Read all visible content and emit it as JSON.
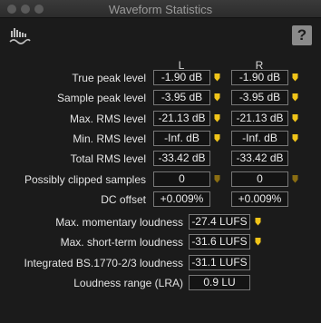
{
  "window": {
    "title": "Waveform Statistics"
  },
  "header": {
    "help_label": "?"
  },
  "columns": {
    "left": "L",
    "right": "R"
  },
  "rows": [
    {
      "label": "True peak level",
      "left": "-1.90 dB",
      "right": "-1.90 dB",
      "left_marker": "bright",
      "right_marker": "bright"
    },
    {
      "label": "Sample peak level",
      "left": "-3.95 dB",
      "right": "-3.95 dB",
      "left_marker": "bright",
      "right_marker": "bright"
    },
    {
      "label": "Max. RMS level",
      "left": "-21.13 dB",
      "right": "-21.13 dB",
      "left_marker": "bright",
      "right_marker": "bright"
    },
    {
      "label": "Min. RMS level",
      "left": "-Inf. dB",
      "right": "-Inf. dB",
      "left_marker": "bright",
      "right_marker": "bright"
    },
    {
      "label": "Total RMS level",
      "left": "-33.42 dB",
      "right": "-33.42 dB",
      "left_marker": "none",
      "right_marker": "none"
    },
    {
      "label": "Possibly clipped samples",
      "left": "0",
      "right": "0",
      "left_marker": "dim",
      "right_marker": "dim"
    },
    {
      "label": "DC offset",
      "left": "+0.009%",
      "right": "+0.009%",
      "left_marker": "none",
      "right_marker": "none"
    }
  ],
  "loudness": [
    {
      "label": "Max. momentary loudness",
      "value": "-27.4 LUFS",
      "marker": "bright"
    },
    {
      "label": "Max. short-term loudness",
      "value": "-31.6 LUFS",
      "marker": "bright"
    },
    {
      "label": "Integrated BS.1770-2/3 loudness",
      "value": "-31.1 LUFS",
      "marker": "none"
    },
    {
      "label": "Loudness range (LRA)",
      "value": "0.9 LU",
      "marker": "none"
    }
  ],
  "colors": {
    "marker_bright": "#f0c419",
    "marker_dim": "#8a6d12"
  }
}
